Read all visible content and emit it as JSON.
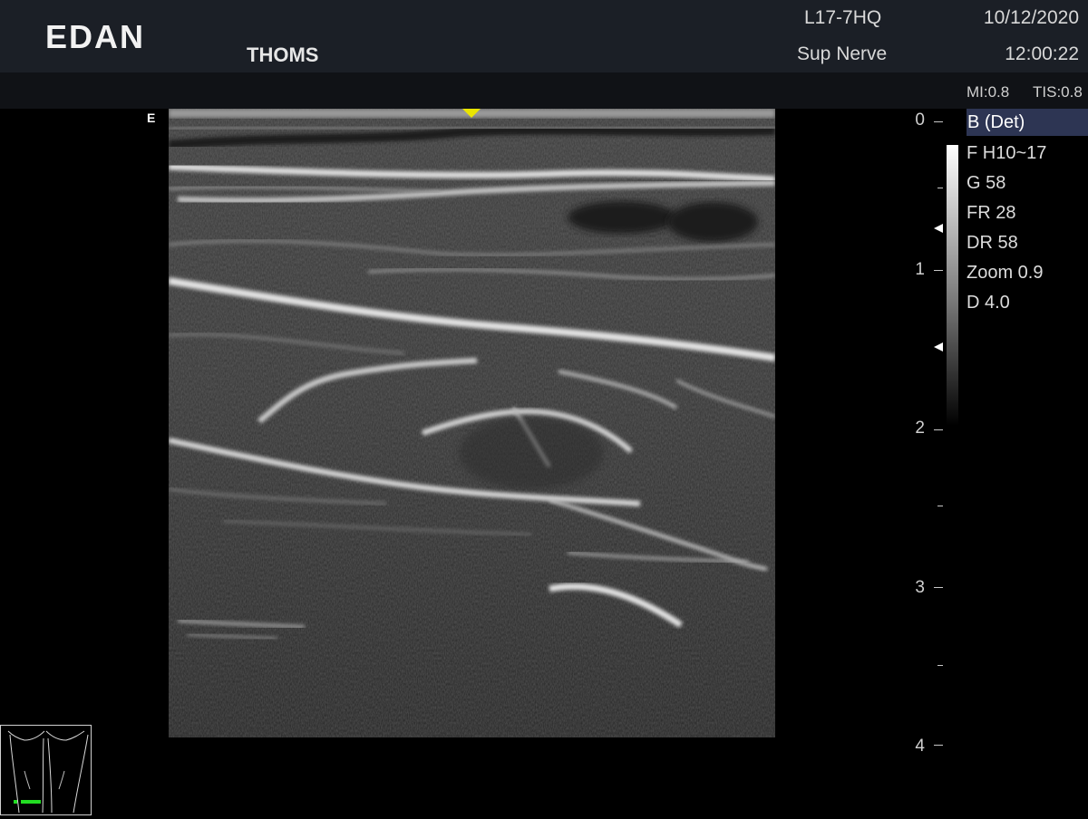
{
  "header": {
    "logo": "EDAN",
    "hospital": "THOMS",
    "probe": "L17-7HQ",
    "preset": "Sup Nerve",
    "date": "10/12/2020",
    "time": "12:00:22"
  },
  "acoustic": {
    "mi": "MI:0.8",
    "tis": "TIS:0.8"
  },
  "image": {
    "orientation_mark": "E"
  },
  "depth_scale": {
    "labels": [
      "0",
      "1",
      "2",
      "3",
      "4"
    ]
  },
  "params": {
    "mode": "B (Det)",
    "items": [
      "F H10~17",
      "G 58",
      "FR 28",
      "DR 58",
      "Zoom 0.9",
      "D 4.0"
    ]
  },
  "colors": {
    "header_bg": "#1b1f26",
    "mode_highlight": "#2d3553",
    "focus_marker": "#e9e400",
    "probe_marker": "#22dd22"
  },
  "icons": [
    "focus-position-icon",
    "body-mark-icon",
    "probe-position-icon",
    "focus-marker-icon"
  ]
}
